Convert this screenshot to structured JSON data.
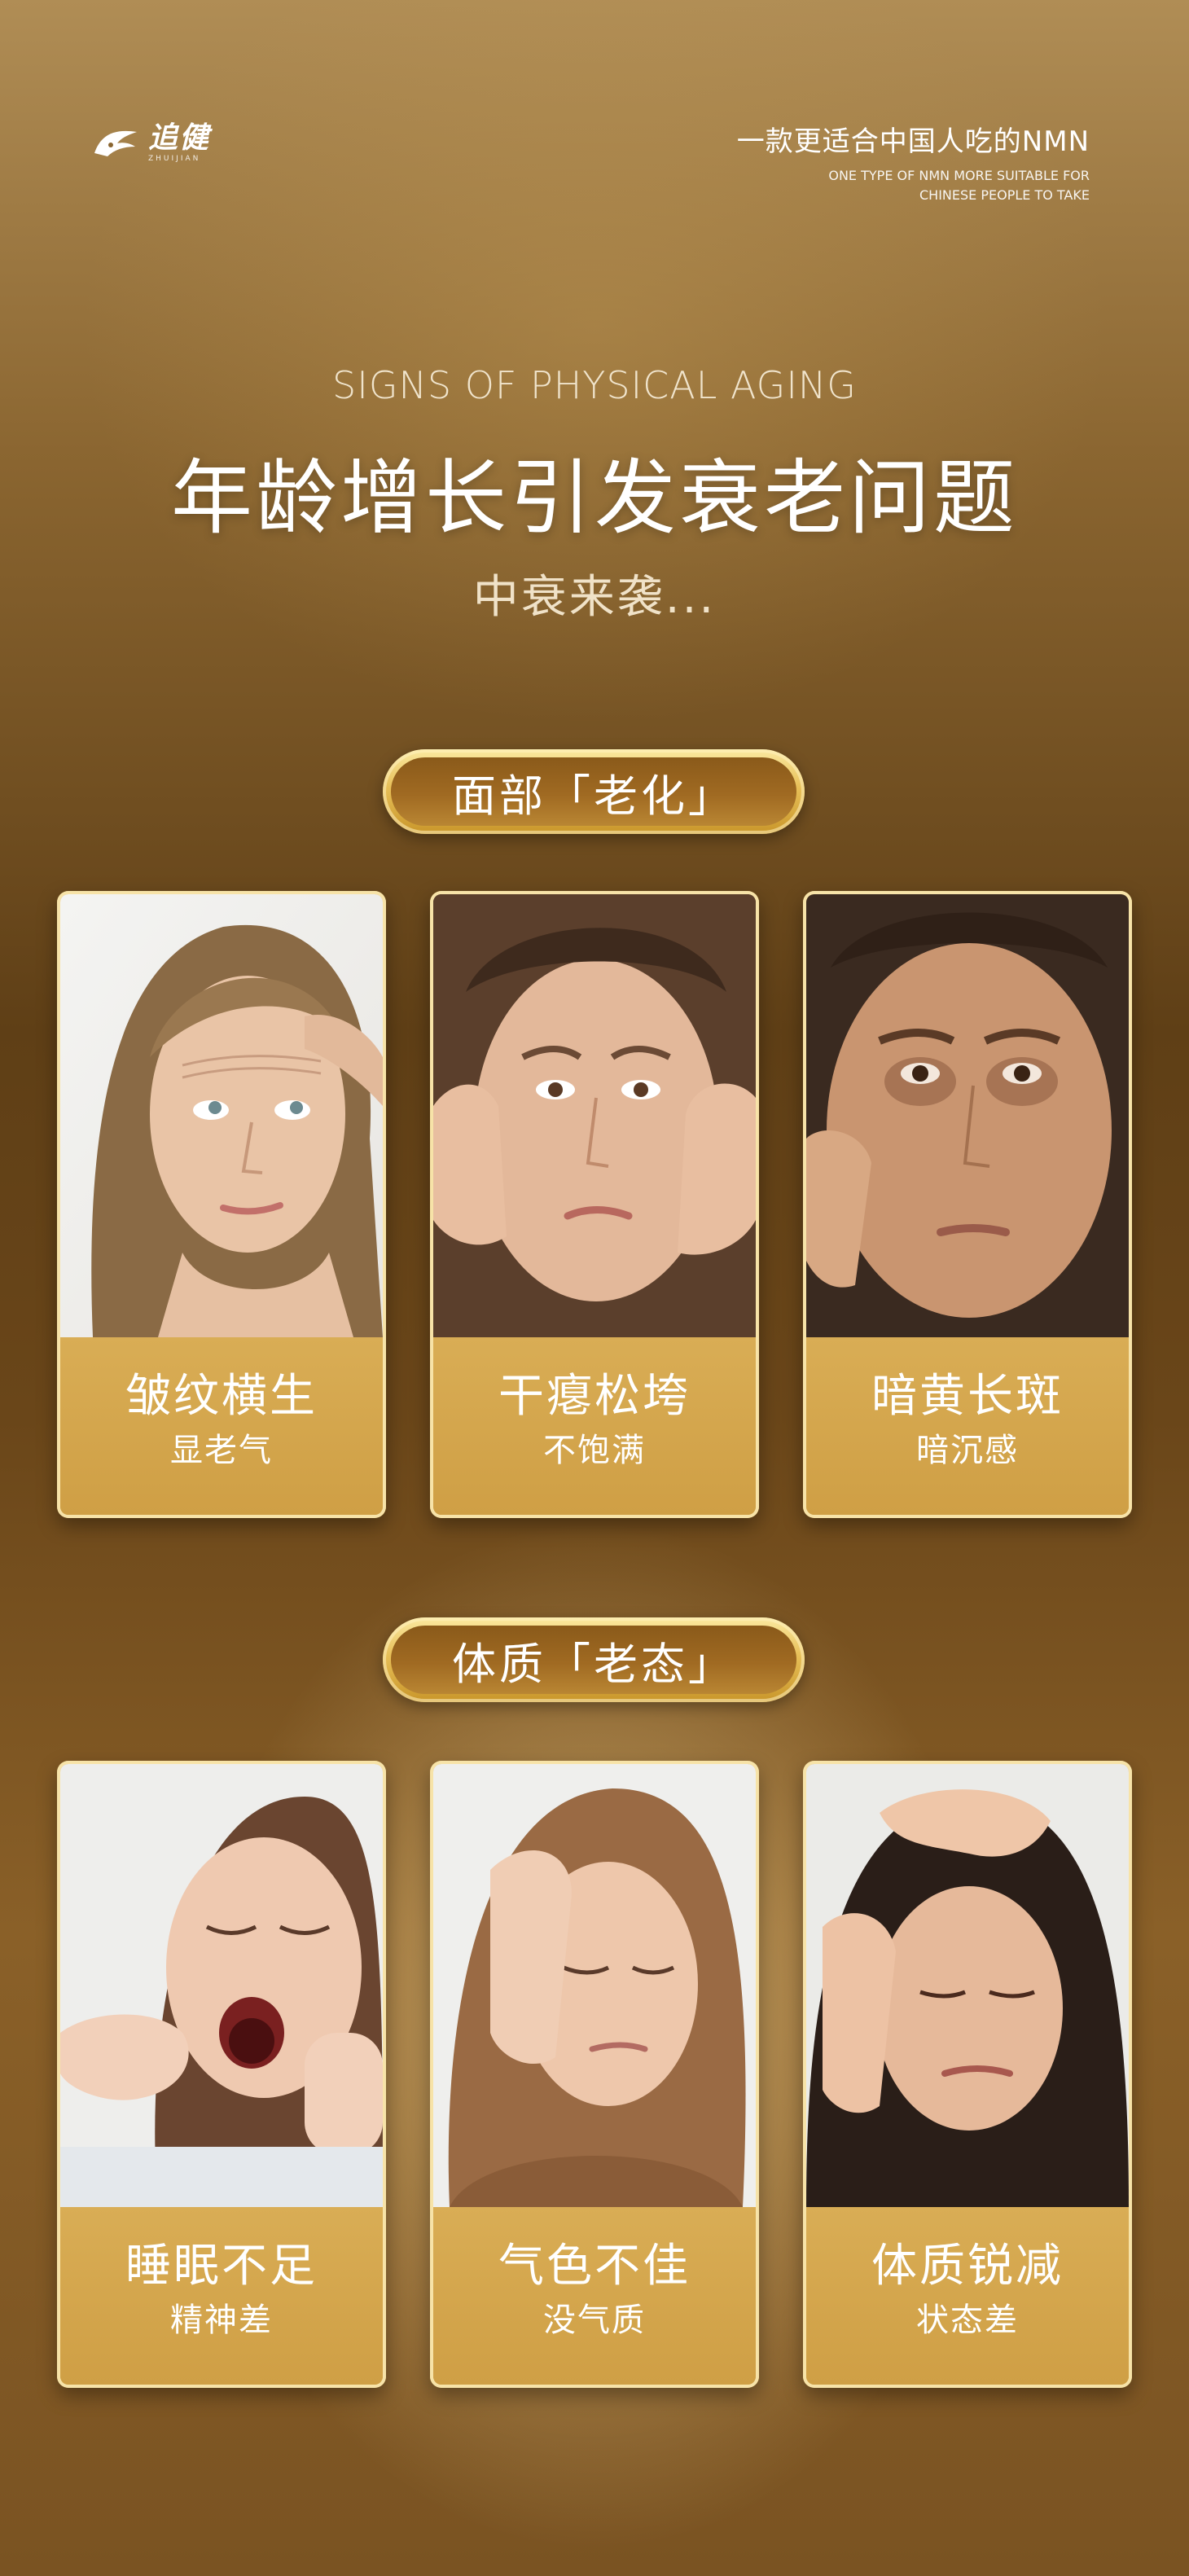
{
  "brand": {
    "name": "追健",
    "sub": "ZHUIJIAN"
  },
  "tagline": {
    "cn": "一款更适合中国人吃的NMN",
    "en_line1": "ONE TYPE OF NMN MORE SUITABLE FOR",
    "en_line2": "CHINESE PEOPLE TO TAKE"
  },
  "heading": {
    "en": "SIGNS OF PHYSICAL AGING",
    "cn": "年龄增长引发衰老问题",
    "sub": "中衰来袭..."
  },
  "sections": [
    {
      "label": "面部「老化」",
      "cards": [
        {
          "title": "皱纹横生",
          "desc": "显老气"
        },
        {
          "title": "干瘪松垮",
          "desc": "不饱满"
        },
        {
          "title": "暗黄长斑",
          "desc": "暗沉感"
        }
      ]
    },
    {
      "label": "体质「老态」",
      "cards": [
        {
          "title": "睡眠不足",
          "desc": "精神差"
        },
        {
          "title": "气色不佳",
          "desc": "没气质"
        },
        {
          "title": "体质锐减",
          "desc": "状态差"
        }
      ]
    }
  ],
  "colors": {
    "gold": "#d8ad56",
    "pill_gold": "#e7bf58",
    "brown_dark": "#5f3f16"
  }
}
